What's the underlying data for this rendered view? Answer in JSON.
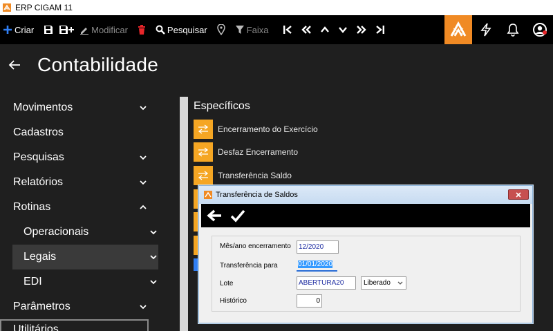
{
  "window": {
    "title": "ERP CIGAM 11"
  },
  "toolbar": {
    "criar": "Criar",
    "modificar": "Modificar",
    "pesquisar": "Pesquisar",
    "faixa": "Faixa"
  },
  "page": {
    "title": "Contabilidade"
  },
  "sidebar": {
    "items": [
      {
        "label": "Movimentos"
      },
      {
        "label": "Cadastros"
      },
      {
        "label": "Pesquisas"
      },
      {
        "label": "Relatórios"
      },
      {
        "label": "Rotinas"
      },
      {
        "label": "Operacionais"
      },
      {
        "label": "Legais"
      },
      {
        "label": "EDI"
      },
      {
        "label": "Parâmetros"
      },
      {
        "label": "Utilitários"
      }
    ]
  },
  "especificos": {
    "title": "Específicos",
    "items": [
      {
        "label": "Encerramento do Exercício"
      },
      {
        "label": "Desfaz Encerramento"
      },
      {
        "label": "Transferência Saldo"
      }
    ]
  },
  "dialog": {
    "title": "Transferência de Saldos",
    "fields": {
      "mes_ano_label": "Mês/ano encerramento",
      "mes_ano_value": "12/2020",
      "transferencia_label": "Transferência para",
      "transferencia_value": "01/01/2020",
      "lote_label": "Lote",
      "lote_value": "ABERTURA20",
      "lote_status": "Liberado",
      "historico_label": "Histórico",
      "historico_value": "0"
    }
  },
  "colors": {
    "accent": "#f08a24",
    "item_icon": "#f5a623",
    "toolbar_bg": "#000000",
    "page_bg": "#1f1f1f"
  }
}
